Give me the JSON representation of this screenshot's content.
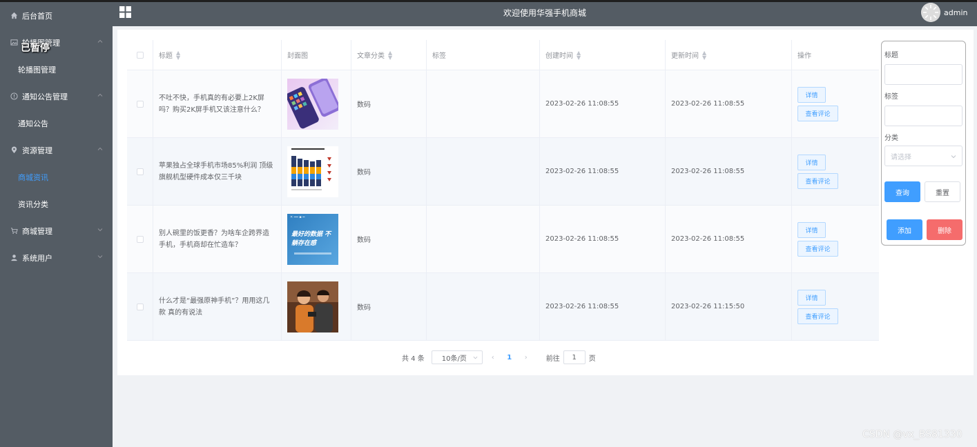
{
  "sidebar": {
    "overlay_text": "已暂停",
    "items": [
      {
        "label": "后台首页",
        "icon": "home-icon"
      },
      {
        "label": "轮播图管理",
        "icon": "picture-icon"
      },
      {
        "label": "轮播图管理",
        "icon": ""
      },
      {
        "label": "通知公告管理",
        "icon": "info-icon"
      },
      {
        "label": "通知公告",
        "icon": ""
      },
      {
        "label": "资源管理",
        "icon": "location-icon"
      },
      {
        "label": "商城资讯",
        "icon": ""
      },
      {
        "label": "资讯分类",
        "icon": ""
      },
      {
        "label": "商城管理",
        "icon": "cart-icon"
      },
      {
        "label": "系统用户",
        "icon": "user-icon"
      }
    ]
  },
  "header": {
    "title": "欢迎使用华强手机商城",
    "username": "admin"
  },
  "table": {
    "columns": [
      "标题",
      "封面图",
      "文章分类",
      "标签",
      "创建时间",
      "更新时间",
      "操作"
    ],
    "rows": [
      {
        "title": "不吐不快，手机真的有必要上2K屏吗？购买2K屏手机又该注意什么？",
        "category": "数码",
        "tag": "",
        "created": "2023-02-26 11:08:55",
        "updated": "2023-02-26 11:08:55"
      },
      {
        "title": "苹果独占全球手机市场85%利润 顶级旗舰机型硬件成本仅三千块",
        "category": "数码",
        "tag": "",
        "created": "2023-02-26 11:08:55",
        "updated": "2023-02-26 11:08:55"
      },
      {
        "title": "别人碗里的饭更香？为啥车企跨界造手机，手机商却在忙造车？",
        "category": "数码",
        "tag": "",
        "created": "2023-02-26 11:08:55",
        "updated": "2023-02-26 11:08:55"
      },
      {
        "title": "什么才是“最强原神手机”？用用这几款 真的有说法",
        "category": "数码",
        "tag": "",
        "created": "2023-02-26 11:08:55",
        "updated": "2023-02-26 11:15:50"
      }
    ],
    "detail_label": "详情",
    "comment_label": "查看评论",
    "thumb2_text": "最好的数据 不躺存在感"
  },
  "pager": {
    "total": "共 4 条",
    "page_size": "10条/页",
    "current": "1",
    "goto_prefix": "前往",
    "goto_value": "1",
    "goto_suffix": "页"
  },
  "search": {
    "title_label": "标题",
    "tag_label": "标签",
    "category_label": "分类",
    "category_placeholder": "请选择",
    "query_label": "查询",
    "reset_label": "重置",
    "add_label": "添加",
    "delete_label": "删除"
  },
  "watermark": "CSDN @vx_BS81330",
  "colors": {
    "sidebar_bg": "#545c64",
    "accent": "#409eff",
    "danger": "#f56c6c"
  }
}
